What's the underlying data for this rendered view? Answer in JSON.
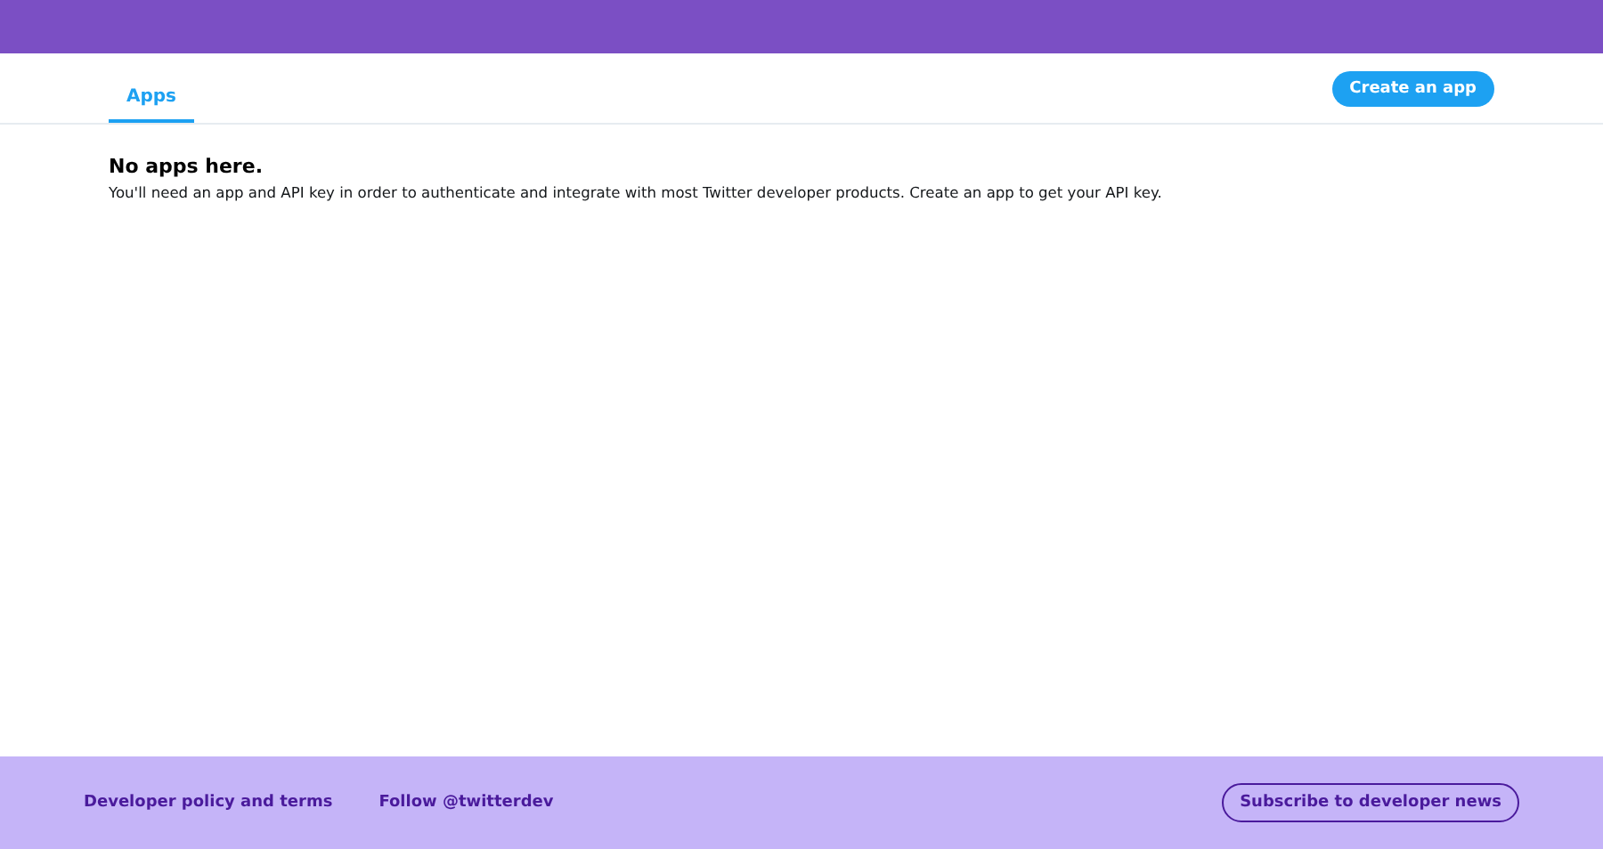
{
  "tabs": [
    {
      "label": "Apps",
      "selected": true
    }
  ],
  "create_button": "Create an app",
  "empty_state": {
    "title": "No apps here.",
    "message": "You'll need an app and API key in order to authenticate and integrate with most Twitter developer products. Create an app to get your API key."
  },
  "footer": {
    "links": [
      "Developer policy and terms",
      "Follow @twitterdev"
    ],
    "subscribe_button": "Subscribe to developer news"
  }
}
